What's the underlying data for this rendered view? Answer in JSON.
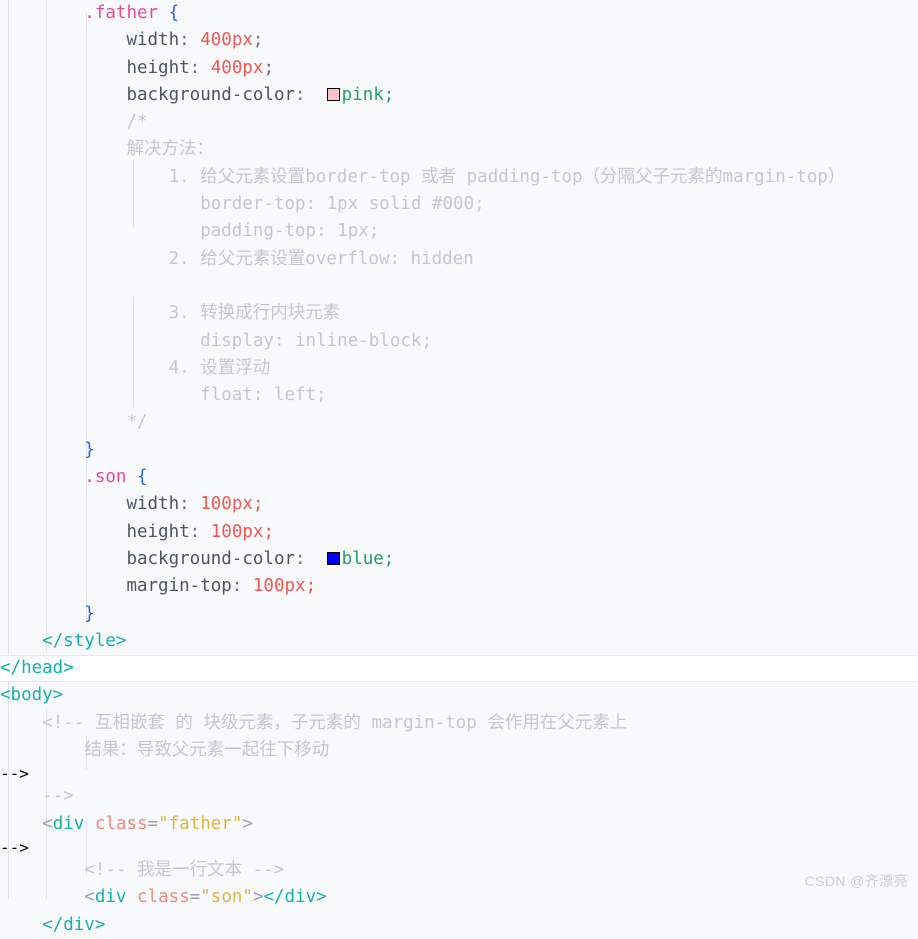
{
  "editor": {
    "background": "#f8f9fb",
    "font_size_px": 17.5,
    "line_height_px": 27.3,
    "indent_guide_color": "#dfe2ea",
    "current_line": "</head>"
  },
  "colors": {
    "selector": "#ec4899",
    "brace": "#2563eb",
    "property": "#4b5563",
    "punctuation": "#6b7280",
    "number": "#f4574f",
    "color_keyword": "#22a06b",
    "comment": "#c3c7d1",
    "tag": "#17b0b0",
    "tag_punct": "#9aa2b1",
    "attribute": "#f4877f",
    "attr_value": "#e2b53e",
    "swatch_pink": "#ffc0cb",
    "swatch_blue": "#0000ff"
  },
  "code": {
    "css_block": {
      "father_rule": {
        "selector": ".father",
        "open_brace": "{",
        "close_brace": "}",
        "declarations": [
          {
            "property": "width",
            "colon": ":",
            "value": "400px",
            "semicolon": ";"
          },
          {
            "property": "height",
            "colon": ":",
            "value": "400px",
            "semicolon": ";"
          },
          {
            "property": "background-color",
            "colon": ":",
            "value": "pink",
            "semicolon": ";",
            "swatch": "#ffc0cb"
          }
        ],
        "comment": {
          "open": "/*",
          "heading": "解决方法：",
          "items": [
            {
              "marker": "1.",
              "text": "给父元素设置border-top 或者 padding-top（分隔父子元素的margin-top）"
            },
            {
              "marker": "",
              "text": "border-top: 1px solid #000;"
            },
            {
              "marker": "",
              "text": "padding-top: 1px;"
            },
            {
              "marker": "2.",
              "text": "给父元素设置overflow: hidden"
            },
            {
              "marker": "",
              "text": ""
            },
            {
              "marker": "3.",
              "text": "转换成行内块元素"
            },
            {
              "marker": "",
              "text": "display: inline-block;"
            },
            {
              "marker": "4.",
              "text": "设置浮动"
            },
            {
              "marker": "",
              "text": "float: left;"
            }
          ],
          "close": "*/"
        }
      },
      "son_rule": {
        "selector": ".son",
        "open_brace": "{",
        "close_brace": "}",
        "declarations": [
          {
            "property": "width",
            "colon": ":",
            "value": "100px",
            "semicolon": ";"
          },
          {
            "property": "height",
            "colon": ":",
            "value": "100px",
            "semicolon": ";"
          },
          {
            "property": "background-color",
            "colon": ":",
            "value": "blue",
            "semicolon": ";",
            "swatch": "#0000ff"
          },
          {
            "property": "margin-top",
            "colon": ":",
            "value": "100px",
            "semicolon": ";"
          }
        ]
      },
      "style_close_tag": "</style>"
    },
    "html_block": {
      "head_close_tag": "</head>",
      "body_open_tag": "<body>",
      "body_comment": {
        "open": "<!--",
        "line1": "互相嵌套 的 块级元素，子元素的 margin-top 会作用在父元素上",
        "line2": "结果：导致父元素一起往下移动",
        "close": "-->"
      },
      "father_div": {
        "open_lt": "<",
        "tag": "div",
        "space": " ",
        "attr": "class",
        "eq": "=",
        "quote_open": "\"",
        "attr_value": "father",
        "quote_close": "\"",
        "close_gt": ">"
      },
      "inner_comment": "<!-- 我是一行文本 -->",
      "son_div": {
        "open_lt": "<",
        "tag": "div",
        "attr": "class",
        "eq": "=",
        "attr_value": "son",
        "close_gt": ">",
        "closing": "</div>"
      },
      "father_div_close": "</div>"
    }
  },
  "watermark": {
    "text": "CSDN @齐漂亮"
  }
}
